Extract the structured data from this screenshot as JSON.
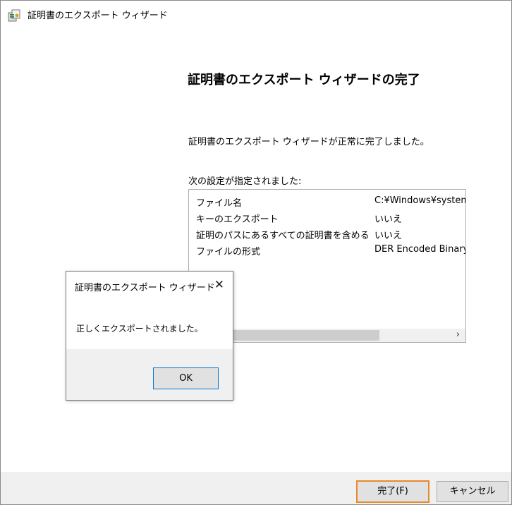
{
  "window": {
    "title": "証明書のエクスポート ウィザード"
  },
  "main": {
    "heading": "証明書のエクスポート ウィザードの完了",
    "done_text": "証明書のエクスポート ウィザードが正常に完了しました。",
    "settings_label": "次の設定が指定されました:",
    "settings": [
      {
        "key": "ファイル名",
        "value": "C:¥Windows¥system"
      },
      {
        "key": "キーのエクスポート",
        "value": "いいえ"
      },
      {
        "key": "証明のパスにあるすべての証明書を含める",
        "value": "いいえ"
      },
      {
        "key": "ファイルの形式",
        "value": "DER Encoded Binary"
      }
    ],
    "scroll_arrow": "›"
  },
  "footer": {
    "finish_label": "完了(F)",
    "cancel_label": "キャンセル"
  },
  "dialog": {
    "title": "証明書のエクスポート ウィザード",
    "close": "✕",
    "message": "正しくエクスポートされました。",
    "ok_label": "OK"
  }
}
